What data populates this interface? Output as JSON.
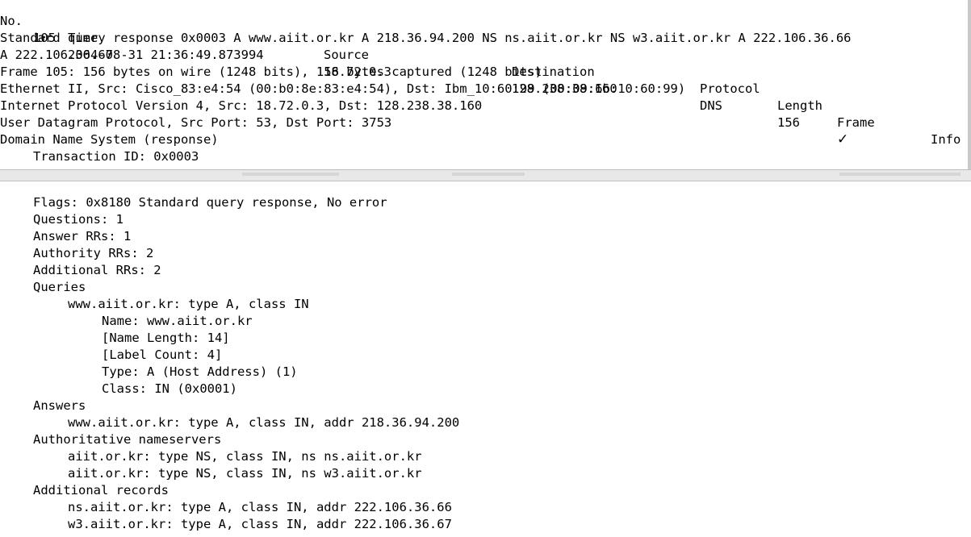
{
  "packet_list": {
    "headers": {
      "no": "No.",
      "time": "Time",
      "source": "Source",
      "destination": "Destination",
      "protocol": "Protocol",
      "length": "Length",
      "frame": "Frame",
      "info": "Info"
    },
    "row": {
      "no": "105",
      "time": "2004-08-31 21:36:49.873994",
      "source": "18.72.0.3",
      "destination": "128.238.38.160",
      "protocol": "DNS",
      "length": "156",
      "frame": "✓"
    },
    "info_line1": "Standard query response 0x0003 A www.aiit.or.kr A 218.36.94.200 NS ns.aiit.or.kr NS w3.aiit.or.kr A 222.106.36.66",
    "info_line2": "A 222.106.36.67"
  },
  "details": {
    "frame": "Frame 105: 156 bytes on wire (1248 bits), 156 bytes captured (1248 bits)",
    "ethernet": "Ethernet II, Src: Cisco_83:e4:54 (00:b0:8e:83:e4:54), Dst: Ibm_10:60:99 (00:09:6b:10:60:99)",
    "ip": "Internet Protocol Version 4, Src: 18.72.0.3, Dst: 128.238.38.160",
    "udp": "User Datagram Protocol, Src Port: 53, Dst Port: 3753",
    "dns": "Domain Name System (response)",
    "transaction_id": "Transaction ID: 0x0003",
    "flags": "Flags: 0x8180 Standard query response, No error",
    "questions": "Questions: 1",
    "answer_rrs": "Answer RRs: 1",
    "authority_rrs": "Authority RRs: 2",
    "additional_rrs": "Additional RRs: 2",
    "queries_header": "Queries",
    "query": "www.aiit.or.kr: type A, class IN",
    "query_name": "Name: www.aiit.or.kr",
    "query_name_length": "[Name Length: 14]",
    "query_label_count": "[Label Count: 4]",
    "query_type": "Type: A (Host Address) (1)",
    "query_class": "Class: IN (0x0001)",
    "answers_header": "Answers",
    "answer": "www.aiit.or.kr: type A, class IN, addr 218.36.94.200",
    "auth_header": "Authoritative nameservers",
    "auth_ns1": "aiit.or.kr: type NS, class IN, ns ns.aiit.or.kr",
    "auth_ns2": "aiit.or.kr: type NS, class IN, ns w3.aiit.or.kr",
    "additional_header": "Additional records",
    "additional1": "ns.aiit.or.kr: type A, class IN, addr 222.106.36.66",
    "additional2": "w3.aiit.or.kr: type A, class IN, addr 222.106.36.67"
  }
}
